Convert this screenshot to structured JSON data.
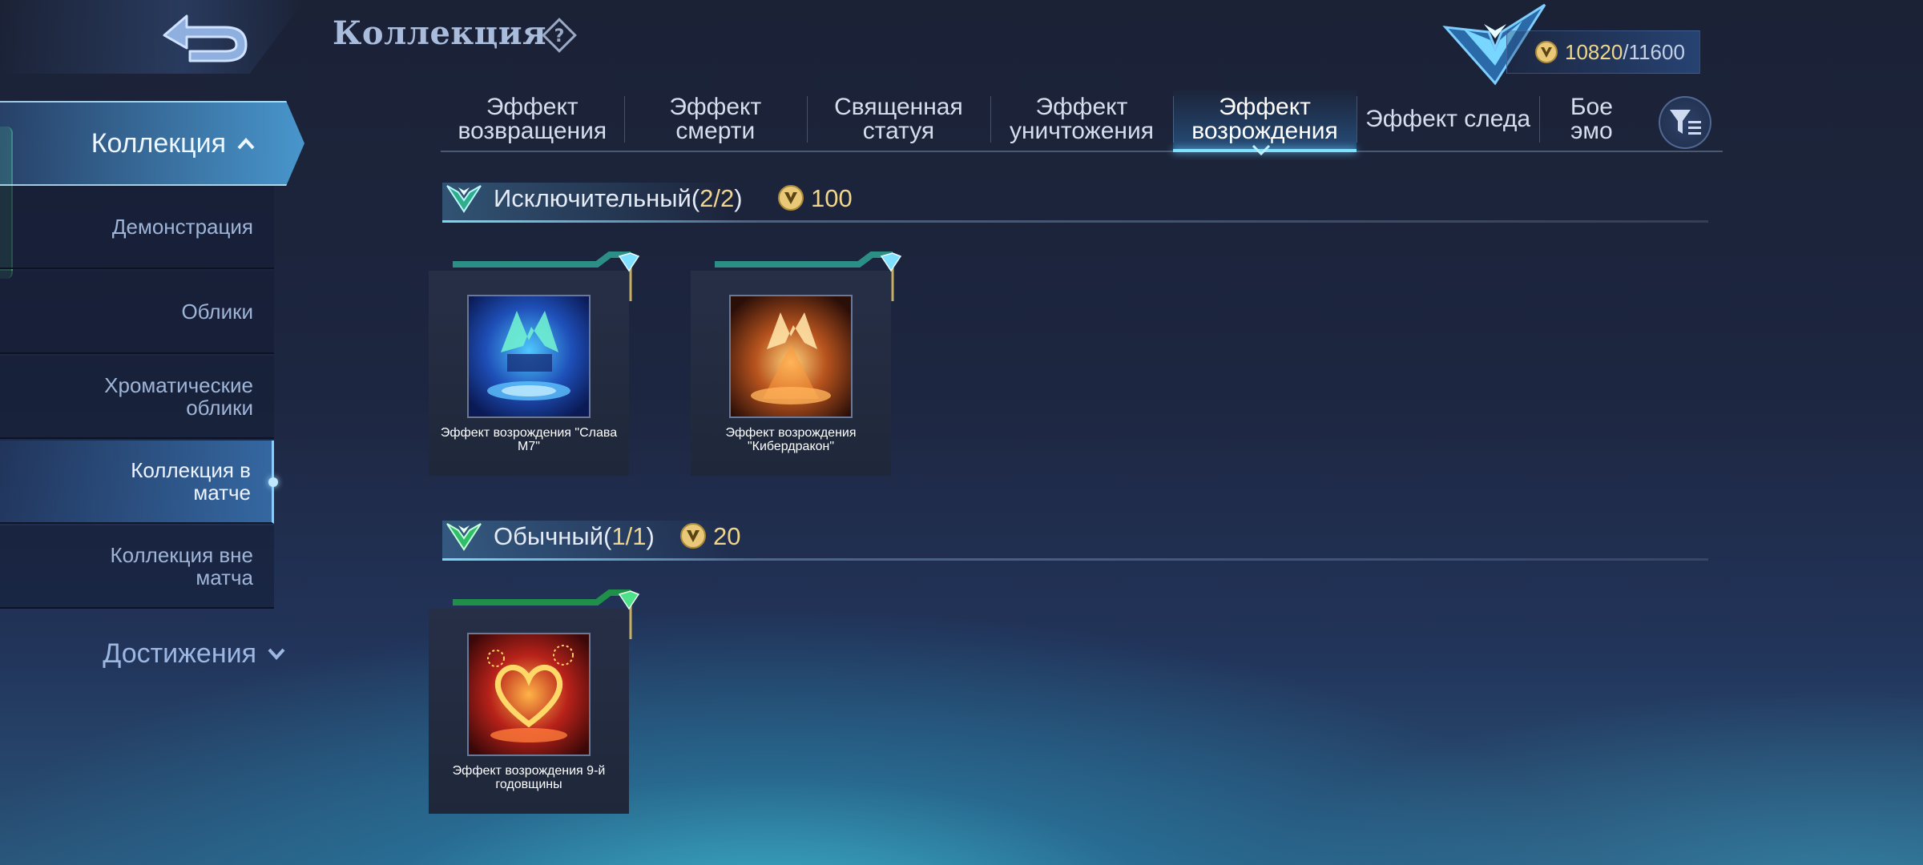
{
  "header": {
    "title": "Коллекция",
    "points_current": "10820",
    "points_separator": "/",
    "points_max": "11600"
  },
  "sidebar": {
    "collection_label": "Коллекция",
    "items": [
      {
        "label": "Демонстрация"
      },
      {
        "label": "Облики"
      },
      {
        "label": "Хроматические облики"
      },
      {
        "label": "Коллекция в матче"
      },
      {
        "label": "Коллекция вне матча"
      }
    ],
    "achievements_label": "Достижения"
  },
  "tabs": [
    {
      "label": "Эффект возвращения"
    },
    {
      "label": "Эффект смерти"
    },
    {
      "label": "Священная статуя"
    },
    {
      "label": "Эффект уничтожения"
    },
    {
      "label": "Эффект возрождения"
    },
    {
      "label": "Эффект следа"
    },
    {
      "label": "Бое эмо"
    }
  ],
  "active_tab": "Эффект возрождения",
  "sections": [
    {
      "title": "Исключительный",
      "count_open": "(",
      "count": "2/2",
      "count_close": ")",
      "points": "100",
      "items": [
        {
          "name": "Эффект возрождения \"Слава М7\""
        },
        {
          "name": "Эффект возрождения \"Кибердракон\""
        }
      ]
    },
    {
      "title": "Обычный",
      "count_open": "(",
      "count": "1/1",
      "count_close": ")",
      "points": "20",
      "items": [
        {
          "name": "Эффект возрождения 9-й годовщины"
        }
      ]
    }
  ],
  "colors": {
    "gold": "#f0d58c",
    "accent_blue": "#7fe0ff",
    "exclusive_green": "#2fae8c",
    "common_green": "#2fbe6a"
  },
  "icons": {
    "back": "back-arrow-icon",
    "help": "question-diamond-icon",
    "rank": "rank-emblem-icon",
    "coin": "collection-point-coin-icon",
    "filter": "filter-icon"
  }
}
